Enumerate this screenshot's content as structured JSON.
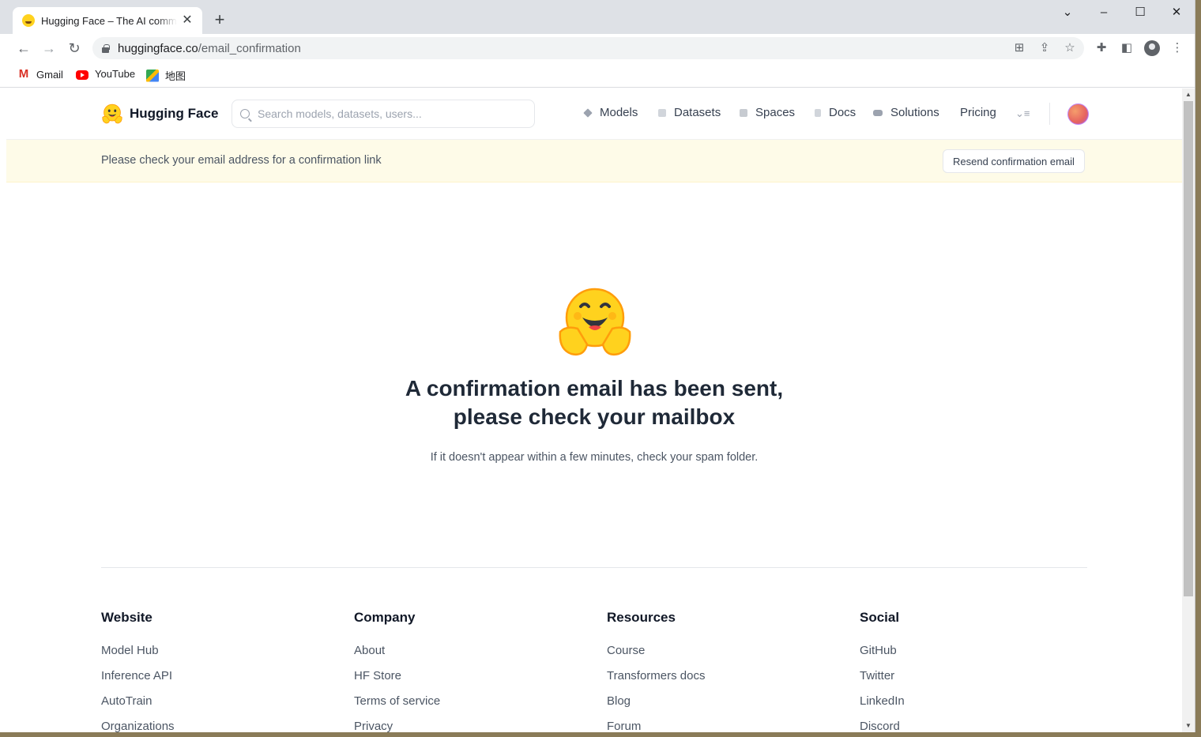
{
  "browser": {
    "tab_title": "Hugging Face – The AI commu",
    "url_host": "huggingface.co",
    "url_path": "/email_confirmation",
    "bookmarks": [
      {
        "label": "Gmail",
        "icon": "gmail-icon"
      },
      {
        "label": "YouTube",
        "icon": "youtube-icon"
      },
      {
        "label": "地图",
        "icon": "maps-icon"
      }
    ]
  },
  "header": {
    "brand": "Hugging Face",
    "search_placeholder": "Search models, datasets, users...",
    "nav": [
      {
        "label": "Models",
        "icon": "models-icon"
      },
      {
        "label": "Datasets",
        "icon": "datasets-icon"
      },
      {
        "label": "Spaces",
        "icon": "spaces-icon"
      },
      {
        "label": "Docs",
        "icon": "docs-icon"
      },
      {
        "label": "Solutions",
        "icon": "solutions-icon"
      },
      {
        "label": "Pricing",
        "icon": ""
      }
    ]
  },
  "banner": {
    "message": "Please check your email address for a confirmation link",
    "button": "Resend confirmation email"
  },
  "main": {
    "headline_line1": "A confirmation email has been sent,",
    "headline_line2": "please check your mailbox",
    "subtext": "If it doesn't appear within a few minutes, check your spam folder."
  },
  "footer": {
    "columns": [
      {
        "title": "Website",
        "links": [
          "Model Hub",
          "Inference API",
          "AutoTrain",
          "Organizations"
        ]
      },
      {
        "title": "Company",
        "links": [
          "About",
          "HF Store",
          "Terms of service",
          "Privacy"
        ]
      },
      {
        "title": "Resources",
        "links": [
          "Course",
          "Transformers docs",
          "Blog",
          "Forum"
        ]
      },
      {
        "title": "Social",
        "links": [
          "GitHub",
          "Twitter",
          "LinkedIn",
          "Discord"
        ]
      }
    ]
  },
  "colors": {
    "brand_yellow": "#FFD21E",
    "banner_bg": "#FEFBE8",
    "text_dark": "#1F2937"
  }
}
